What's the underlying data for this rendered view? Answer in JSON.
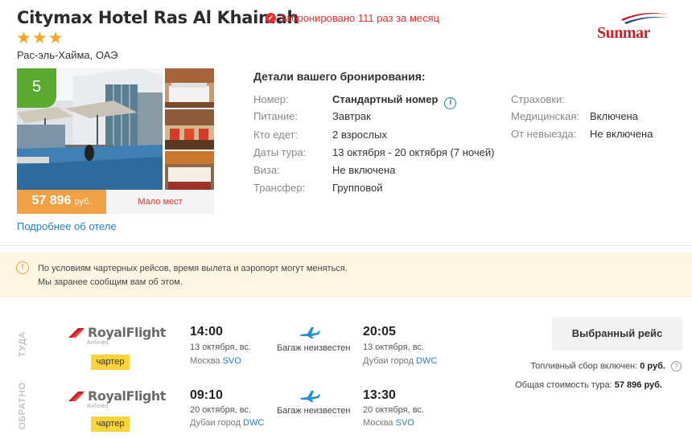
{
  "hotel": {
    "name": "Citymax Hotel Ras Al Khaimah",
    "booked_badge": "Забронировано 111 раз за месяц",
    "stars": "★★★",
    "location": "Рас-эль-Хайма, ОАЭ",
    "rating": "5",
    "price": "57 896",
    "price_currency": "руб.",
    "few_places": "Мало мест",
    "more_link": "Подробнее об отеле"
  },
  "operator_logo": "Sunmar",
  "colors": {
    "accent_red": "#e2312f",
    "rating_green": "#5ba930",
    "price_orange": "#f0a045",
    "link_blue": "#1f7fc9",
    "charter_yellow": "#fbd33b",
    "notice_bg": "#fdf6e3"
  },
  "booking": {
    "title": "Детали вашего бронирования:",
    "left": [
      {
        "label": "Номер:",
        "value": "Стандартный номер"
      },
      {
        "label": "Питание:",
        "value": "Завтрак"
      },
      {
        "label": "Кто едет:",
        "value": "2 взрослых"
      },
      {
        "label": "Даты тура:",
        "value": "13 октября - 20 октября (7 ночей)"
      },
      {
        "label": "Виза:",
        "value": "Не включена"
      },
      {
        "label": "Трансфер:",
        "value": "Групповой"
      }
    ],
    "insurance_title": "Страховки:",
    "right": [
      {
        "label": "Медицинская:",
        "value": "Включена"
      },
      {
        "label": "От невыезда:",
        "value": "Не включена"
      }
    ]
  },
  "notice": {
    "line1": "По условиям чартерных рейсов, время вылета и аэропорт могут меняться.",
    "line2": "Мы заранее сообщим вам об этом."
  },
  "flights": {
    "there_label": "ТУДА",
    "back_label": "ОБРАТНО",
    "airline": "RoyalFlight",
    "airline_sub": "Airlines",
    "charter": "чартер",
    "there": {
      "dep_time": "14:00",
      "dep_date": "13 октября, вс.",
      "dep_city": "Москва",
      "dep_code": "SVO",
      "baggage": "Багаж неизвестен",
      "arr_time": "20:05",
      "arr_date": "13 октября, вс.",
      "arr_city": "Дубаи город",
      "arr_code": "DWC"
    },
    "back": {
      "dep_time": "09:10",
      "dep_date": "20 октября, вс.",
      "dep_city": "Дубаи город",
      "dep_code": "DWC",
      "baggage": "Багаж неизвестен",
      "arr_time": "13:30",
      "arr_date": "20 октября, вс.",
      "arr_city": "Москва",
      "arr_code": "SVO"
    },
    "selected_button": "Выбранный рейс",
    "fuel_label": "Топливный сбор включен:",
    "fuel_value": "0 руб.",
    "total_label": "Общая стоимость тура:",
    "total_value": "57 896 руб."
  }
}
